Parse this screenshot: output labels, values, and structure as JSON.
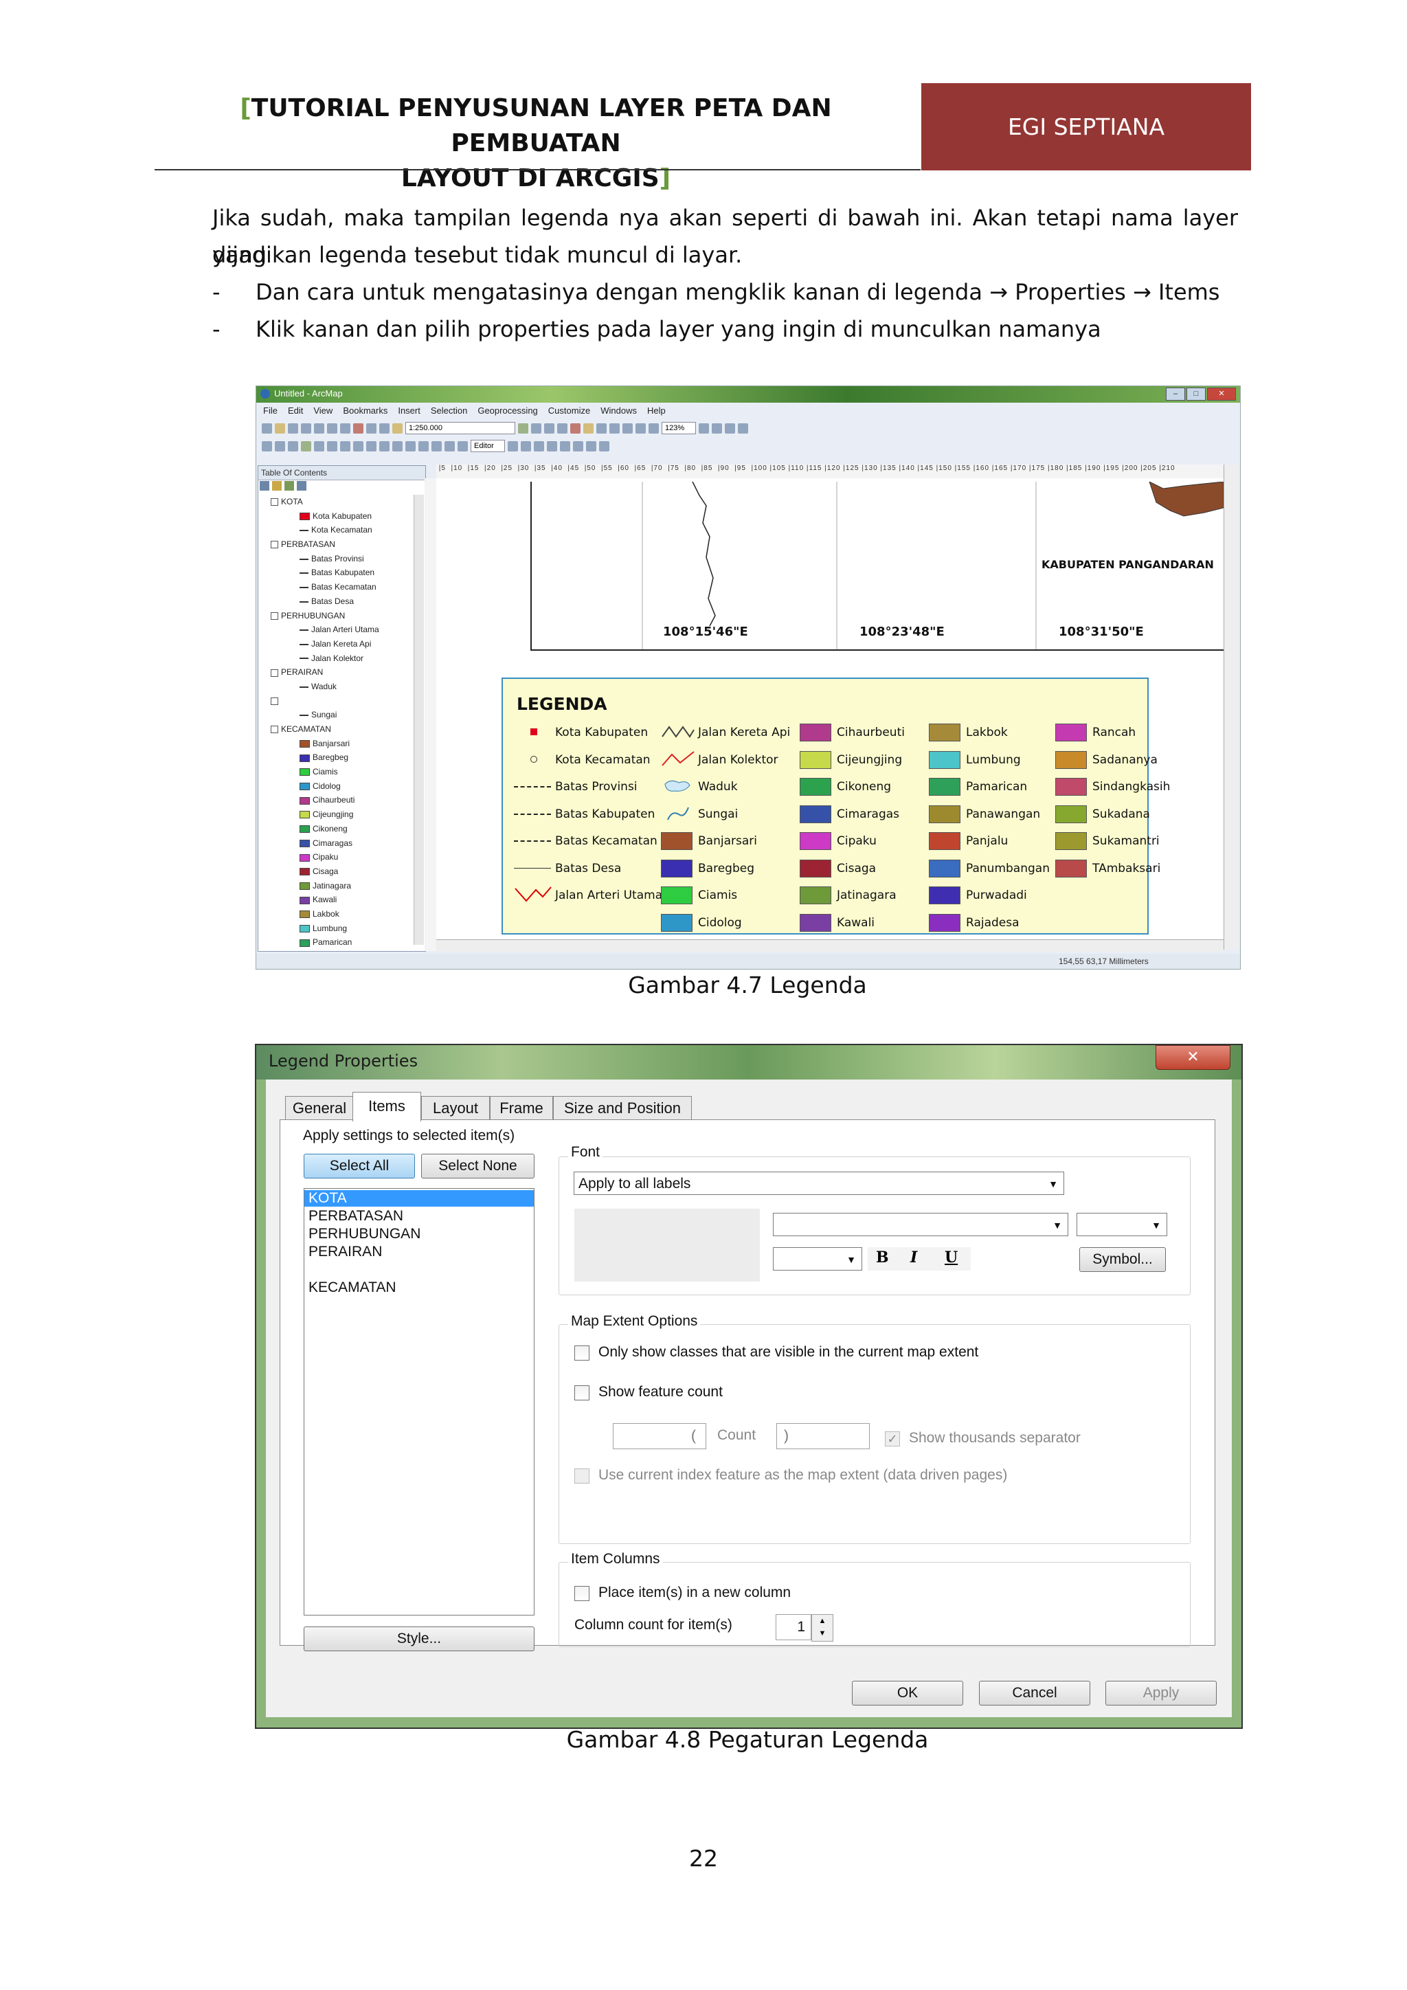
{
  "header": {
    "title_bracket_open": "[",
    "title_line1": "TUTORIAL PENYUSUNAN LAYER PETA DAN PEMBUATAN",
    "title_line2": "LAYOUT DI ARCGIS",
    "title_bracket_close": "]",
    "author": "EGI SEPTIANA"
  },
  "body": {
    "paragraph_line1": "Jika sudah, maka tampilan legenda nya akan seperti di bawah ini. Akan tetapi nama layer yang",
    "paragraph_line2": "dijadikan legenda tesebut tidak muncul di layar.",
    "bullets": [
      {
        "dash": "-",
        "text": "Dan cara untuk mengatasinya dengan mengklik kanan di legenda → Properties → Items"
      },
      {
        "dash": "-",
        "text": "Klik kanan dan pilih properties pada layer yang ingin di munculkan namanya"
      }
    ]
  },
  "figure1": {
    "caption": "Gambar 4.7 Legenda",
    "window_title": "Untitled - ArcMap",
    "menu": [
      "File",
      "Edit",
      "View",
      "Bookmarks",
      "Insert",
      "Selection",
      "Geoprocessing",
      "Customize",
      "Windows",
      "Help"
    ],
    "scale": "1:250.000",
    "zoom": "123%",
    "editor_label": "Editor",
    "toc_title": "Table Of Contents",
    "toc_items": [
      {
        "label": "KOTA",
        "level": 0
      },
      {
        "label": "Kota Kabupaten",
        "level": 1,
        "color": "#e0001b"
      },
      {
        "label": "Kota Kecamatan",
        "level": 1
      },
      {
        "label": "PERBATASAN",
        "level": 0
      },
      {
        "label": "Batas Provinsi",
        "level": 1
      },
      {
        "label": "Batas Kabupaten",
        "level": 1
      },
      {
        "label": "Batas Kecamatan",
        "level": 1
      },
      {
        "label": "Batas Desa",
        "level": 1
      },
      {
        "label": "PERHUBUNGAN",
        "level": 0
      },
      {
        "label": "Jalan Arteri Utama",
        "level": 1
      },
      {
        "label": "Jalan Kereta Api",
        "level": 1
      },
      {
        "label": "Jalan Kolektor",
        "level": 1
      },
      {
        "label": "PERAIRAN",
        "level": 0
      },
      {
        "label": "Waduk",
        "level": 1
      },
      {
        "label": "",
        "level": 0
      },
      {
        "label": "Sungai",
        "level": 1
      },
      {
        "label": "KECAMATAN",
        "level": 0
      },
      {
        "label": "Banjarsari",
        "level": 1,
        "color": "#a0522d"
      },
      {
        "label": "Baregbeg",
        "level": 1,
        "color": "#3a2fb0"
      },
      {
        "label": "Ciamis",
        "level": 1,
        "color": "#2ecc40"
      },
      {
        "label": "Cidolog",
        "level": 1,
        "color": "#2f96c8"
      },
      {
        "label": "Cihaurbeuti",
        "level": 1,
        "color": "#b03a8c"
      },
      {
        "label": "Cijeungjing",
        "level": 1,
        "color": "#c6d94a"
      },
      {
        "label": "Cikoneng",
        "level": 1,
        "color": "#2ca24f"
      },
      {
        "label": "Cimaragas",
        "level": 1,
        "color": "#3652a8"
      },
      {
        "label": "Cipaku",
        "level": 1,
        "color": "#cc3ac6"
      },
      {
        "label": "Cisaga",
        "level": 1,
        "color": "#9c2432"
      },
      {
        "label": "Jatinagara",
        "level": 1,
        "color": "#6f9a3a"
      },
      {
        "label": "Kawali",
        "level": 1,
        "color": "#7a3fa2"
      },
      {
        "label": "Lakbok",
        "level": 1,
        "color": "#a58a3a"
      },
      {
        "label": "Lumbung",
        "level": 1,
        "color": "#4cc4c8"
      },
      {
        "label": "Pamarican",
        "level": 1,
        "color": "#2ea05a"
      }
    ],
    "map_labels": {
      "regency": "KABUPATEN PANGANDARAN",
      "lon1": "108°15'46\"E",
      "lon2": "108°23'48\"E",
      "lon3": "108°31'50\"E"
    },
    "legend_title": "LEGENDA",
    "legend_col1": [
      "Kota Kabupaten",
      "Kota Kecamatan",
      "Batas Provinsi",
      "Batas Kabupaten",
      "Batas Kecamatan",
      "Batas Desa",
      "Jalan Arteri Utama"
    ],
    "legend_col2": [
      "Jalan Kereta Api",
      "Jalan Kolektor",
      "Waduk",
      "Sungai",
      "Banjarsari",
      "Baregbeg",
      "Ciamis",
      "Cidolog"
    ],
    "legend_col3": [
      "Cihaurbeuti",
      "Cijeungjing",
      "Cikoneng",
      "Cimaragas",
      "Cipaku",
      "Cisaga",
      "Jatinagara",
      "Kawali"
    ],
    "legend_col4": [
      "Lakbok",
      "Lumbung",
      "Pamarican",
      "Panawangan",
      "Panjalu",
      "Panumbangan",
      "Purwadadi",
      "Rajadesa"
    ],
    "legend_col5": [
      "Rancah",
      "Sadananya",
      "Sindangkasih",
      "Sukadana",
      "Sukamantri",
      "TAmbaksari"
    ],
    "colors_col2": [
      "",
      "",
      "",
      "",
      "#a0522d",
      "#3a2fb0",
      "#2ecc40",
      "#2f96c8"
    ],
    "colors_col3": [
      "#b03a8c",
      "#c6d94a",
      "#2ca24f",
      "#3652a8",
      "#cc3ac6",
      "#9c2432",
      "#6f9a3a",
      "#7a3fa2"
    ],
    "colors_col4": [
      "#a58a3a",
      "#4cc4c8",
      "#2ea05a",
      "#9d8a2e",
      "#c0452e",
      "#3a6cc0",
      "#3f2fb0",
      "#8a2ec0"
    ],
    "colors_col5": [
      "#c43ab0",
      "#c98a2a",
      "#c04a6a",
      "#86a82e",
      "#9c9a2e",
      "#b84a4a"
    ],
    "status_text": "154,55  63,17 Millimeters"
  },
  "figure2": {
    "caption": "Gambar 4.8 Pegaturan Legenda",
    "window_title": "Legend Properties",
    "close_glyph": "✕",
    "tabs": [
      "General",
      "Items",
      "Layout",
      "Frame",
      "Size and Position"
    ],
    "active_tab": "Items",
    "apply_settings_label": "Apply settings to selected item(s)",
    "select_all": "Select All",
    "select_none": "Select None",
    "items": [
      "KOTA",
      "PERBATASAN",
      "PERHUBUNGAN",
      "PERAIRAN",
      "",
      "KECAMATAN"
    ],
    "selected_item": "KOTA",
    "style_button": "Style...",
    "font_group": "Font",
    "font_apply": "Apply to all labels",
    "bold": "B",
    "italic": "I",
    "underline": "U",
    "symbol_button": "Symbol...",
    "map_extent_group": "Map Extent Options",
    "only_visible": "Only show classes that are visible in the current map extent",
    "show_count": "Show feature count",
    "count_open": "(",
    "count_label": "Count",
    "count_close": ")",
    "thousands_sep": "Show thousands separator",
    "index_feature": "Use current index feature as the map extent (data driven pages)",
    "item_columns_group": "Item Columns",
    "place_new_column": "Place item(s) in a new column",
    "column_count_label": "Column count for item(s)",
    "column_count_value": "1",
    "ok": "OK",
    "cancel": "Cancel",
    "apply": "Apply"
  },
  "page_number": "22"
}
